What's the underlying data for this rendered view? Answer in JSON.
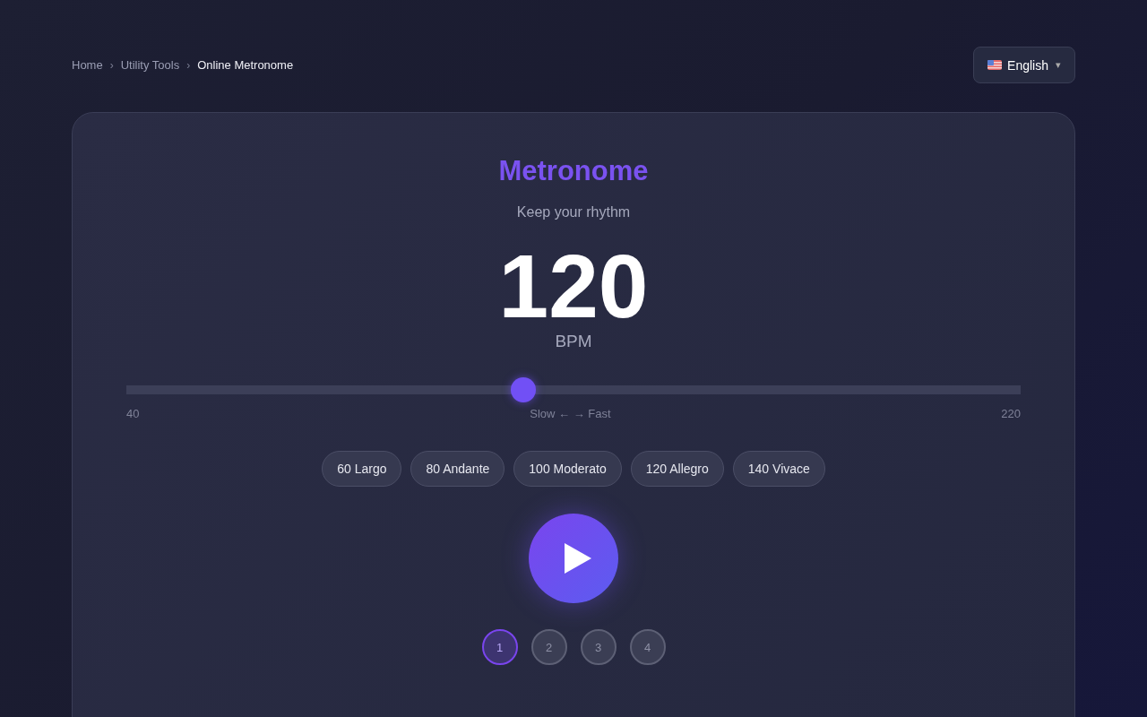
{
  "breadcrumb": [
    {
      "label": "Home",
      "current": false
    },
    {
      "label": "Utility Tools",
      "current": false
    },
    {
      "label": "Online Metronome",
      "current": true
    }
  ],
  "breadcrumb_separator": "›",
  "language": {
    "label": "English",
    "caret": "▾"
  },
  "title": "Metronome",
  "subtitle": "Keep your rhythm",
  "tempo": {
    "value": "120",
    "unit": "BPM"
  },
  "slider": {
    "level": 0.444,
    "min_label": "40",
    "mid_label": "Slow ← → Fast",
    "max_label": "220"
  },
  "presets": [
    {
      "label": "60 Largo"
    },
    {
      "label": "80 Andante"
    },
    {
      "label": "100 Moderato"
    },
    {
      "label": "120 Allegro"
    },
    {
      "label": "140 Vivace"
    }
  ],
  "playing": false,
  "beats": [
    {
      "label": "1",
      "selected": true
    },
    {
      "label": "2",
      "selected": false
    },
    {
      "label": "3",
      "selected": false
    },
    {
      "label": "4",
      "selected": false
    }
  ]
}
